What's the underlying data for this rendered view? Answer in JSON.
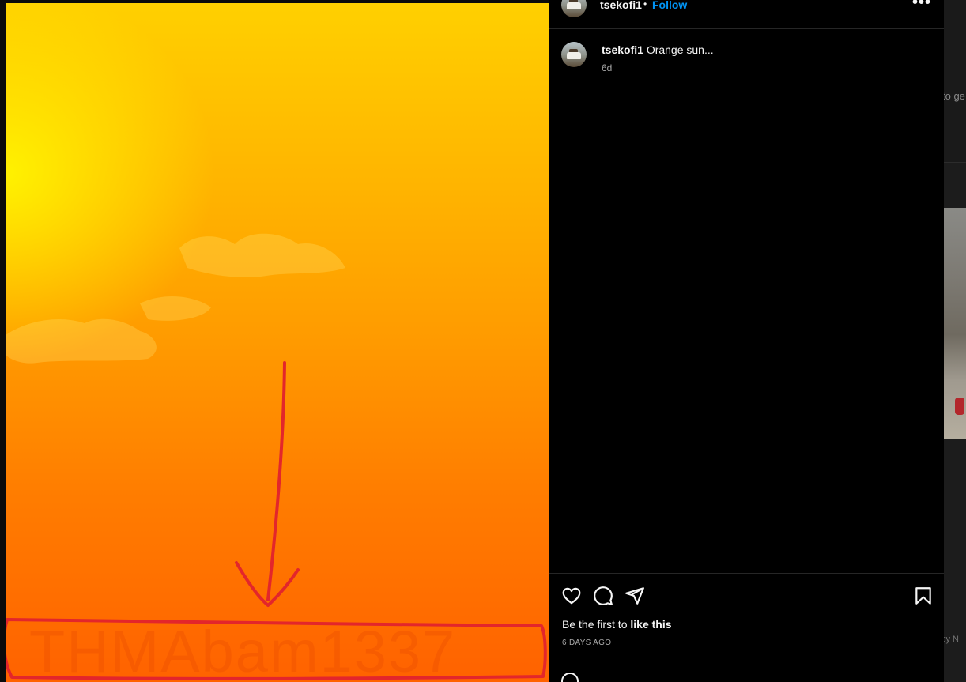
{
  "post": {
    "username": "tsekofi1",
    "separator": "•",
    "follow_label": "Follow",
    "more_label": "•••",
    "image": {
      "watermark_text": "THMAbam1337",
      "colors": {
        "top": "#ffd000",
        "bottom": "#ff6200",
        "annotation": "#e3262b"
      }
    },
    "caption": {
      "username": "tsekofi1",
      "text": "Orange sun...",
      "time_ago": "6d"
    },
    "icons": {
      "like": "heart-icon",
      "comment": "comment-icon",
      "share": "share-icon",
      "save": "bookmark-icon"
    },
    "likes": {
      "prefix": "Be the first to ",
      "bold": "like this"
    },
    "date": "6 DAYS AGO"
  },
  "background_page": {
    "text_top": "to ge",
    "text_bottom": "cy N"
  },
  "colors": {
    "accent": "#0095f6",
    "background": "#000000",
    "divider": "#262626",
    "muted_text": "#a8a8a8"
  }
}
